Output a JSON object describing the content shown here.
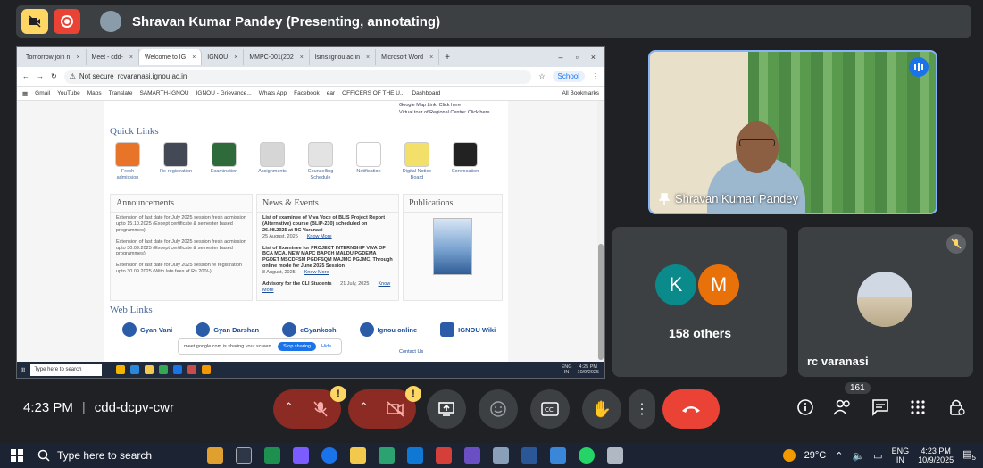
{
  "presenter_bar": {
    "title": "Shravan Kumar Pandey (Presenting, annotating)"
  },
  "browser": {
    "tabs": [
      {
        "label": "Tomorrow join n",
        "active": false
      },
      {
        "label": "Meet - cdd-",
        "active": false
      },
      {
        "label": "Welcome to IG",
        "active": true
      },
      {
        "label": "IGNOU",
        "active": false
      },
      {
        "label": "MMPC-001(202",
        "active": false
      },
      {
        "label": "lsms.ignou.ac.in",
        "active": false
      },
      {
        "label": "Microsoft Word",
        "active": false
      }
    ],
    "not_secure": "Not secure",
    "url": "rcvaranasi.ignou.ac.in",
    "profile": "School",
    "bookmarks": [
      "Gmail",
      "YouTube",
      "Maps",
      "Translate",
      "SAMARTH-IGNOU",
      "IGNOU - Grievance...",
      "Whats App",
      "Facebook",
      "ear",
      "OFFICERS OF THE U...",
      "Dashboard"
    ],
    "all_bookmarks": "All Bookmarks"
  },
  "website": {
    "contact_links": [
      "Google Map Link: Click here",
      "Virtual tour of Regional Centre: Click here"
    ],
    "quick_links_title": "Quick Links",
    "quick_links": [
      {
        "label": "Fresh admission",
        "color": "#e8742a"
      },
      {
        "label": "Re-registration",
        "color": "#444a55"
      },
      {
        "label": "Examination",
        "color": "#2f6b3a"
      },
      {
        "label": "Assignments",
        "color": "#d6d6d6"
      },
      {
        "label": "Counselling Schedule",
        "color": "#e3e3e3"
      },
      {
        "label": "Notification",
        "color": "#ffffff"
      },
      {
        "label": "Digital Notice Board",
        "color": "#f2e06b"
      },
      {
        "label": "Convocation",
        "color": "#222222"
      }
    ],
    "announcements_title": "Announcements",
    "announcements": [
      "Extension of last date for July 2025 session fresh admission upto 15.10.2025 (Except certificate & semester based programmes)",
      "Extension of last date for July 2025 session fresh admission upto 30.09.2025 (Except certificate & semester based programmes)",
      "Extension of last date for July 2025 session re registration upto 30.09.2025 (With late fees of Rs.200/-)"
    ],
    "news_title": "News & Events",
    "news": [
      {
        "text": "List of examinee of Viva Voce of BLIS Project Report (Alternative) course (BLIP-230) scheduled on 26.08.2025 at RC Varanasi",
        "date": "25 August, 2025",
        "more": "Know More"
      },
      {
        "text": "List of Examinee for PROJECT INTERNSHIP VIVA OF BCA MCA, NEW MAPC BAPCH MALDU PGDEMA PGDET MSCDFSM PGDFSQM MAJMC PGJMC, Through online mode for June 2025 Session",
        "date": "8 August, 2025",
        "more": "Know More"
      },
      {
        "text": "Advisory for the CLI Students",
        "date": "21 July, 2025",
        "more": "Know More"
      }
    ],
    "publications_title": "Publications",
    "web_links_title": "Web Links",
    "web_links": [
      "Gyan Vani",
      "Gyan Darshan",
      "eGyankosh",
      "Ignou online",
      "IGNOU Wiki"
    ],
    "share_notice": "meet.google.com is sharing your screen.",
    "stop_sharing": "Stop sharing",
    "hide": "Hide",
    "contact_us": "Contact Us"
  },
  "inner_taskbar": {
    "search": "Type here to search",
    "clock_time": "4:25 PM",
    "clock_date": "10/9/2025",
    "lang": "ENG",
    "region": "IN"
  },
  "tiles": {
    "main_name": "Shravan Kumar Pandey",
    "avatar_k": "K",
    "avatar_m": "M",
    "others": "158 others",
    "rc_name": "rc varanasi"
  },
  "controls": {
    "time": "4:23 PM",
    "meeting_code": "cdd-dcpv-cwr",
    "participants_count": "161",
    "warning": "!"
  },
  "taskbar": {
    "search": "Type here to search",
    "temperature": "29°C",
    "lang": "ENG",
    "region": "IN",
    "time": "4:23 PM",
    "date": "10/9/2025",
    "notif": "5"
  }
}
